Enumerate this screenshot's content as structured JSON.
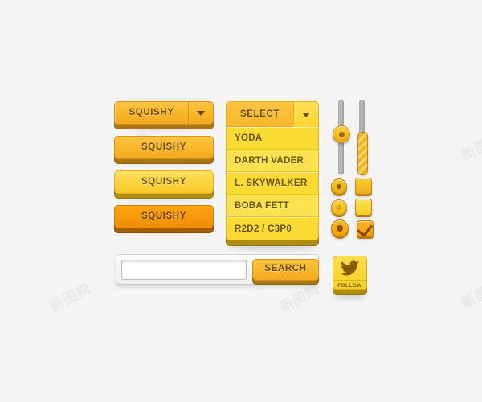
{
  "canvas": {
    "background": "#f4f4f4",
    "watermark_text": "新图网"
  },
  "palette": {
    "gold": "#f9b82c",
    "gold_dark": "#a9750f",
    "yellow": "#fdd43f",
    "yellow_dark": "#b08c10",
    "orange": "#f79a0c",
    "orange_dark": "#a55f02",
    "text_brown": "#6d4908",
    "track_gray": "#bdbdbd",
    "panel_gray": "#f0f0f0"
  },
  "squishy_buttons": [
    {
      "label": "SQUISHY",
      "variant": "gold",
      "has_dropdown": true,
      "arrow_icon": "caret-down-icon"
    },
    {
      "label": "SQUISHY",
      "variant": "gold",
      "has_dropdown": false,
      "arrow_icon": ""
    },
    {
      "label": "SQUISHY",
      "variant": "yellow",
      "has_dropdown": false,
      "arrow_icon": ""
    },
    {
      "label": "SQUISHY",
      "variant": "orange",
      "has_dropdown": false,
      "arrow_icon": ""
    }
  ],
  "select": {
    "header_label": "SELECT",
    "arrow_icon": "caret-down-icon",
    "options": [
      {
        "label": "YODA",
        "tone": "a",
        "selected": false
      },
      {
        "label": "DARTH VADER",
        "tone": "b",
        "selected": true
      },
      {
        "label": "L. SKYWALKER",
        "tone": "a",
        "selected": false
      },
      {
        "label": "BOBA FETT",
        "tone": "b",
        "selected": false
      },
      {
        "label": "R2D2 / C3P0",
        "tone": "a",
        "selected": false
      }
    ]
  },
  "sliders": [
    {
      "name": "slider-knob",
      "style": "knob",
      "value_percent": 40,
      "orientation": "vertical"
    },
    {
      "name": "slider-fill",
      "style": "filled",
      "value_percent": 55,
      "orientation": "vertical"
    }
  ],
  "radios": [
    {
      "state": "on",
      "variant": "dark"
    },
    {
      "state": "off",
      "variant": "light"
    },
    {
      "state": "selected",
      "variant": "active"
    }
  ],
  "checkboxes": [
    {
      "state": "off",
      "variant": "gold",
      "checked": false
    },
    {
      "state": "off",
      "variant": "light",
      "checked": false
    },
    {
      "state": "checked",
      "variant": "active",
      "checked": true
    }
  ],
  "search": {
    "input_value": "",
    "placeholder": "",
    "button_label": "SEARCH",
    "button_variant": "gold"
  },
  "follow": {
    "label": "FOLLOW",
    "icon": "twitter-bird-icon"
  }
}
